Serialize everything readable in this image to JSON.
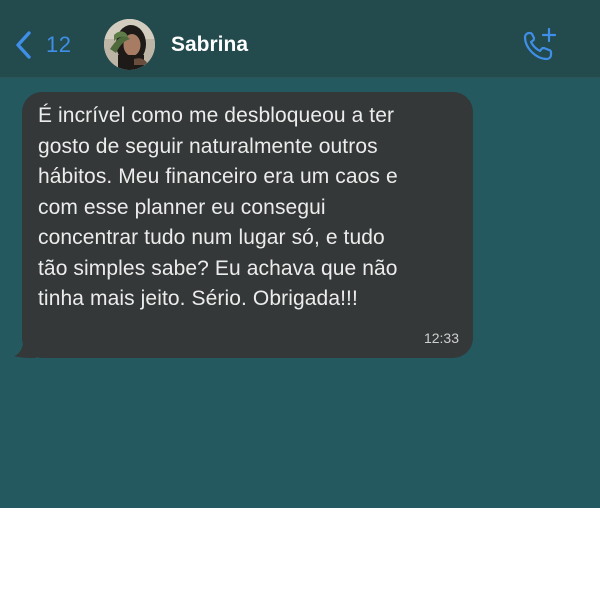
{
  "header": {
    "back_count": "12",
    "contact_name": "Sabrina",
    "back_icon": "chevron-left-icon",
    "call_icon": "phone-add-icon",
    "accent_color": "#3f8fe8"
  },
  "message": {
    "text": "É incrível como me desbloqueou a ter\ngosto de seguir naturalmente outros\nhábitos. Meu financeiro era um caos e\ncom esse planner eu consegui\nconcentrar tudo num lugar só, e tudo\ntão simples sabe? Eu achava que não\ntinha mais jeito. Sério. Obrigada!!!",
    "time": "12:33"
  },
  "colors": {
    "chat_background": "#245a5f",
    "header_background": "#234a4d",
    "bubble_background": "#343838"
  }
}
